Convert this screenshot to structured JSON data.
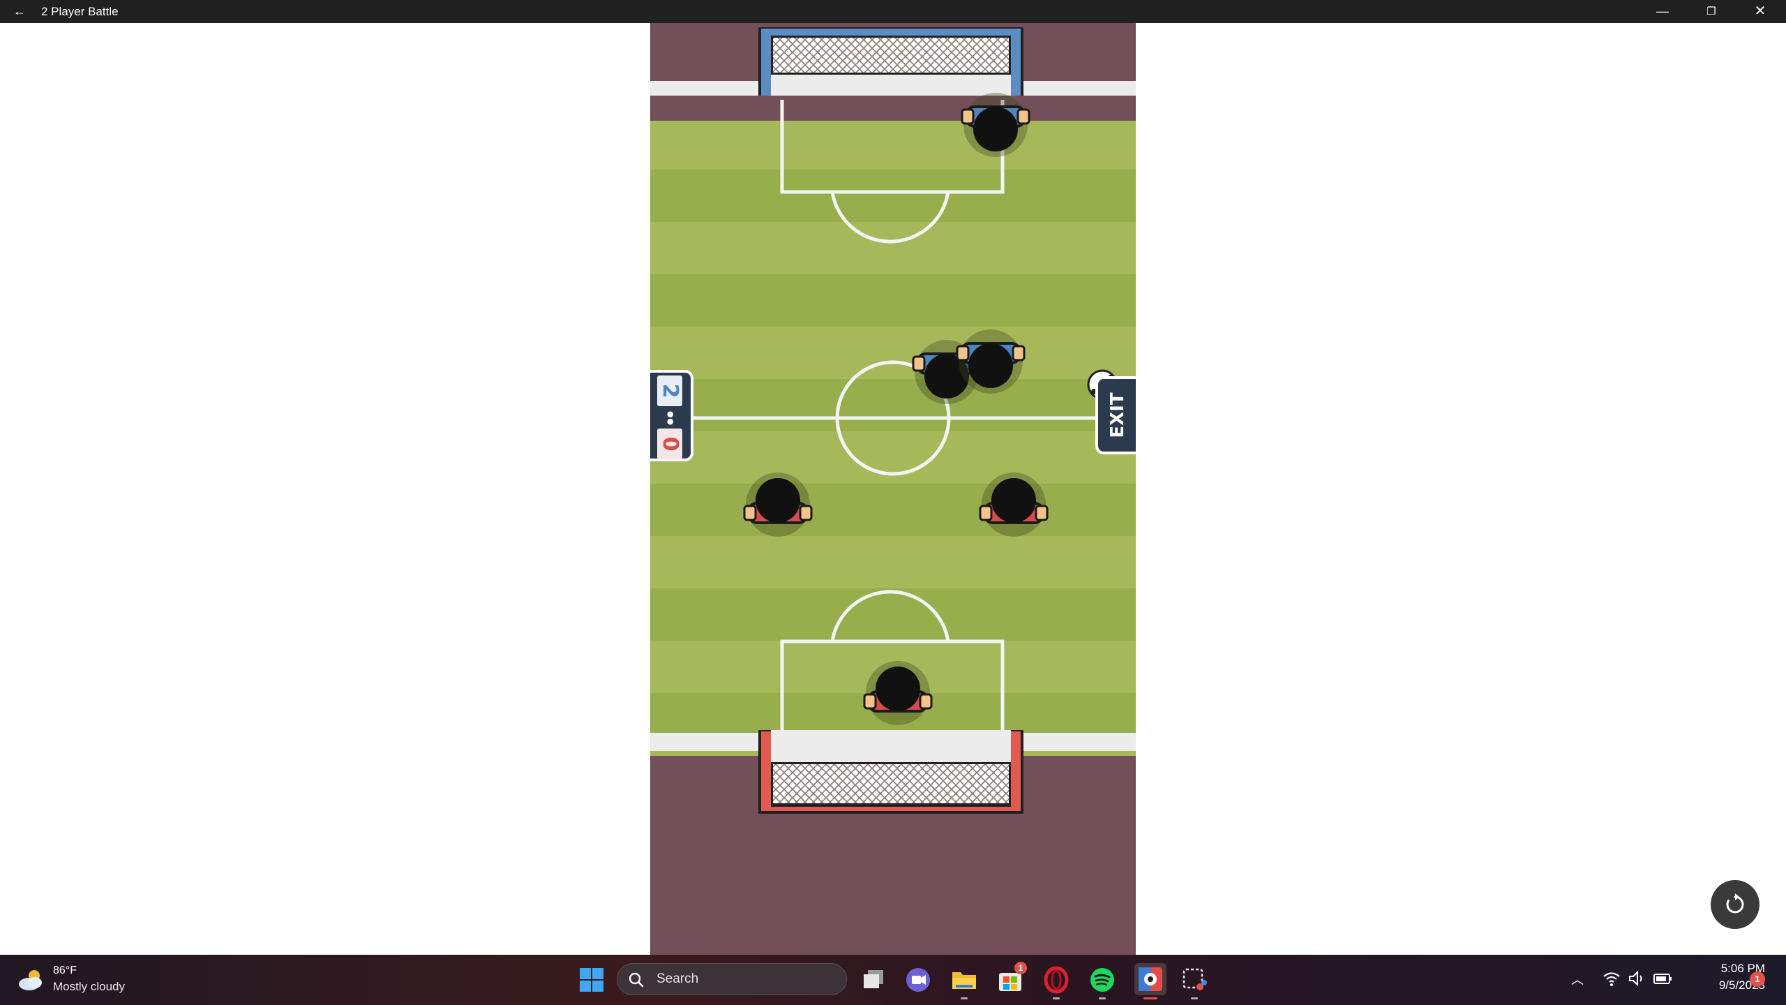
{
  "window": {
    "title": "2 Player Battle",
    "back_glyph": "←",
    "minimize_glyph": "—",
    "maximize_glyph": "❐",
    "close_glyph": "✕"
  },
  "game": {
    "score": {
      "blue": "2",
      "separator": "••",
      "red": "0"
    },
    "exit_label": "EXIT",
    "colors": {
      "stands": "#735059",
      "grass_light": "#a6b85a",
      "grass_dark": "#98ad4b",
      "line": "#ffffff",
      "blue_team": "#4f86bd",
      "red_team": "#d84b4b",
      "goal_frame_blue": "#5b8dc4",
      "goal_frame_red": "#e05a50"
    },
    "players": [
      {
        "team": "blue",
        "role": "goalkeeper"
      },
      {
        "team": "blue",
        "role": "attacker"
      },
      {
        "team": "blue",
        "role": "attacker"
      },
      {
        "team": "red",
        "role": "defender"
      },
      {
        "team": "red",
        "role": "defender"
      },
      {
        "team": "red",
        "role": "goalkeeper"
      }
    ]
  },
  "restart_button": {
    "icon": "restart-icon"
  },
  "taskbar": {
    "weather": {
      "temp": "86°F",
      "condition": "Mostly cloudy",
      "icon": "partly-cloudy-icon"
    },
    "search_placeholder": "Search",
    "store_badge": "1",
    "clock": {
      "time": "5:06 PM",
      "date": "9/5/2023"
    },
    "notification_count": "1"
  }
}
